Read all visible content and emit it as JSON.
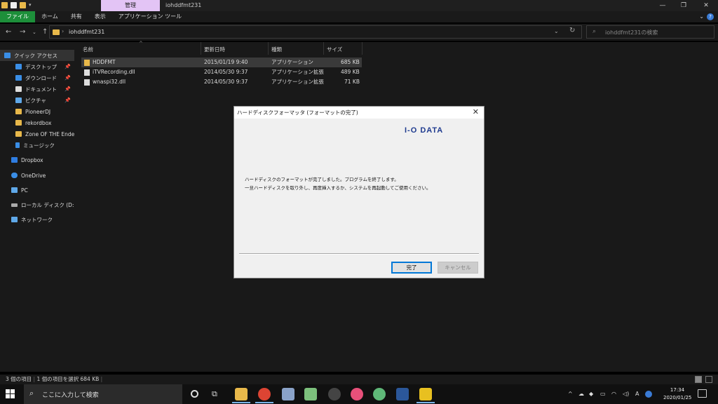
{
  "window": {
    "title": "iohddfmt231",
    "context_tab": "管理",
    "ribbon_tabs": [
      "ファイル",
      "ホーム",
      "共有",
      "表示",
      "アプリケーション ツール"
    ]
  },
  "address": {
    "path": "iohddfmt231",
    "search_placeholder": "iohddfmt231の検索"
  },
  "nav": {
    "items": [
      {
        "label": "クイック アクセス",
        "icon": "star-icon",
        "color": "#3a8ee6",
        "pinned": false,
        "selected": true
      },
      {
        "label": "デスクトップ",
        "icon": "desktop-folder-icon",
        "color": "#3a8ee6",
        "pinned": true
      },
      {
        "label": "ダウンロード",
        "icon": "download-icon",
        "color": "#3a8ee6",
        "pinned": true
      },
      {
        "label": "ドキュメント",
        "icon": "document-icon",
        "color": "#dddddd",
        "pinned": true
      },
      {
        "label": "ピクチャ",
        "icon": "pictures-icon",
        "color": "#5fa8e8",
        "pinned": true
      },
      {
        "label": "PioneerDJ",
        "icon": "folder-icon",
        "color": "#e8b84a",
        "pinned": false
      },
      {
        "label": "rekordbox",
        "icon": "folder-icon",
        "color": "#e8b84a",
        "pinned": false
      },
      {
        "label": "Zone OF THE Ender",
        "icon": "folder-icon",
        "color": "#e8b84a",
        "pinned": false
      },
      {
        "label": "ミュージック",
        "icon": "music-icon",
        "color": "#3a8ee6",
        "pinned": false
      },
      {
        "label": "Dropbox",
        "icon": "dropbox-icon",
        "color": "#2f7de1",
        "pinned": false
      },
      {
        "label": "OneDrive",
        "icon": "onedrive-icon",
        "color": "#3a8ee6",
        "pinned": false
      },
      {
        "label": "PC",
        "icon": "pc-icon",
        "color": "#5fa8e8",
        "pinned": false
      },
      {
        "label": "ローカル ディスク (D:)",
        "icon": "drive-icon",
        "color": "#aaaaaa",
        "pinned": false
      },
      {
        "label": "ネットワーク",
        "icon": "network-icon",
        "color": "#5fa8e8",
        "pinned": false
      }
    ]
  },
  "files": {
    "columns": [
      "名前",
      "更新日時",
      "種類",
      "サイズ"
    ],
    "rows": [
      {
        "name": "HDDFMT",
        "date": "2015/01/19 9:40",
        "type": "アプリケーション",
        "size": "685 KB",
        "icon": "app-icon",
        "selected": true
      },
      {
        "name": "iTVRecording.dll",
        "date": "2014/05/30 9:37",
        "type": "アプリケーション拡張",
        "size": "489 KB",
        "icon": "dll-icon"
      },
      {
        "name": "wnaspi32.dll",
        "date": "2014/05/30 9:37",
        "type": "アプリケーション拡張",
        "size": "71 KB",
        "icon": "dll-icon"
      }
    ]
  },
  "status": {
    "count": "3 個の項目",
    "selection": "1 個の項目を選択  684 KB"
  },
  "dialog": {
    "title": "ハードディスクフォーマッタ (フォーマットの完了)",
    "logo": "I-O DATA",
    "message_1": "ハードディスクのフォーマットが完了しました。プログラムを終了します。",
    "message_2": "一旦ハードディスクを取り外し、再度挿入するか、システムを再起動してご使用ください。",
    "ok_label": "完了",
    "cancel_label": "キャンセル"
  },
  "taskbar": {
    "search_placeholder": "ここに入力して検索",
    "time": "17:34",
    "date": "2020/01/25",
    "ime": "A"
  }
}
